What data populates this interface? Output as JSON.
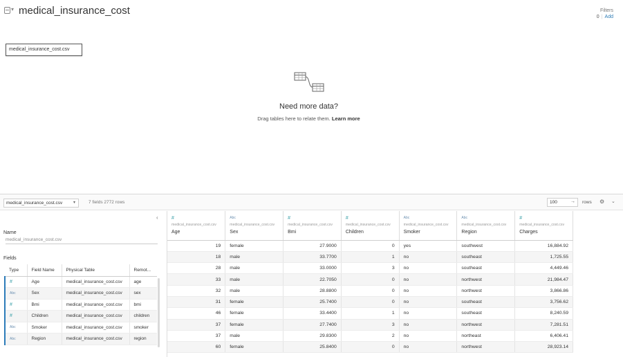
{
  "header": {
    "title": "medical_insurance_cost",
    "filters_label": "Filters",
    "filters_count": "0",
    "filters_add": "Add"
  },
  "canvas": {
    "table_chip": "medical_insurance_cost.csv",
    "need_more_title": "Need more data?",
    "need_more_sub": "Drag tables here to relate them.",
    "learn_more": "Learn more"
  },
  "toolbar": {
    "table_select": "medical_insurance_cost.csv",
    "meta": "7 fields 2772 rows",
    "rows_value": "100",
    "rows_label": "rows"
  },
  "left_panel": {
    "name_label": "Name",
    "name_value": "medical_insurance_cost.csv",
    "fields_label": "Fields",
    "columns": [
      "Type",
      "Field Name",
      "Physical Table",
      "Remot..."
    ],
    "fields": [
      {
        "type": "#",
        "name": "Age",
        "table": "medical_insurance_cost.csv",
        "remote": "age"
      },
      {
        "type": "Abc",
        "name": "Sex",
        "table": "medical_insurance_cost.csv",
        "remote": "sex"
      },
      {
        "type": "#",
        "name": "Bmi",
        "table": "medical_insurance_cost.csv",
        "remote": "bmi"
      },
      {
        "type": "#",
        "name": "Children",
        "table": "medical_insurance_cost.csv",
        "remote": "children"
      },
      {
        "type": "Abc",
        "name": "Smoker",
        "table": "medical_insurance_cost.csv",
        "remote": "smoker"
      },
      {
        "type": "Abc",
        "name": "Region",
        "table": "medical_insurance_cost.csv",
        "remote": "region"
      }
    ]
  },
  "grid": {
    "source": "medical_insurance_cost.csv",
    "columns": [
      {
        "type": "#",
        "name": "Age",
        "numeric": true
      },
      {
        "type": "Abc",
        "name": "Sex",
        "numeric": false
      },
      {
        "type": "#",
        "name": "Bmi",
        "numeric": true
      },
      {
        "type": "#",
        "name": "Children",
        "numeric": true
      },
      {
        "type": "Abc",
        "name": "Smoker",
        "numeric": false
      },
      {
        "type": "Abc",
        "name": "Region",
        "numeric": false
      },
      {
        "type": "#",
        "name": "Charges",
        "numeric": true
      }
    ],
    "rows": [
      [
        "19",
        "female",
        "27.9000",
        "0",
        "yes",
        "southwest",
        "16,884.92"
      ],
      [
        "18",
        "male",
        "33.7700",
        "1",
        "no",
        "southeast",
        "1,725.55"
      ],
      [
        "28",
        "male",
        "33.0000",
        "3",
        "no",
        "southeast",
        "4,449.46"
      ],
      [
        "33",
        "male",
        "22.7050",
        "0",
        "no",
        "northwest",
        "21,984.47"
      ],
      [
        "32",
        "male",
        "28.8800",
        "0",
        "no",
        "northwest",
        "3,866.86"
      ],
      [
        "31",
        "female",
        "25.7400",
        "0",
        "no",
        "southeast",
        "3,756.62"
      ],
      [
        "46",
        "female",
        "33.4400",
        "1",
        "no",
        "southeast",
        "8,240.59"
      ],
      [
        "37",
        "female",
        "27.7400",
        "3",
        "no",
        "northwest",
        "7,281.51"
      ],
      [
        "37",
        "male",
        "29.8300",
        "2",
        "no",
        "northeast",
        "6,406.41"
      ],
      [
        "60",
        "female",
        "25.8400",
        "0",
        "no",
        "northwest",
        "28,923.14"
      ]
    ]
  }
}
